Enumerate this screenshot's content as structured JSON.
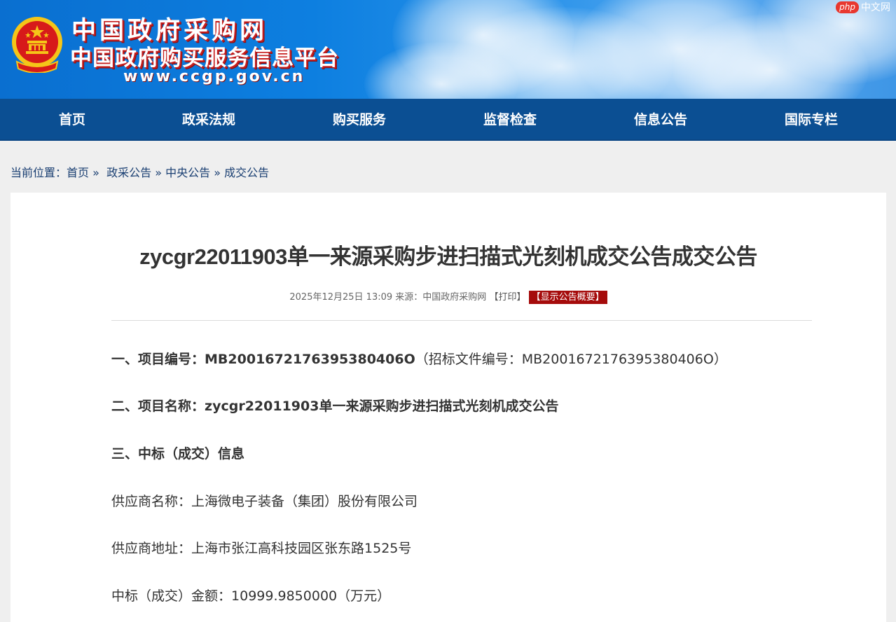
{
  "header": {
    "site_title": "中国政府采购网",
    "site_subtitle": "中国政府购买服务信息平台",
    "site_url": "www.ccgp.gov.cn",
    "watermark_badge": "php",
    "watermark_text": "中文网"
  },
  "nav": {
    "items": [
      {
        "label": "首页"
      },
      {
        "label": "政采法规"
      },
      {
        "label": "购买服务"
      },
      {
        "label": "监督检查"
      },
      {
        "label": "信息公告"
      },
      {
        "label": "国际专栏"
      }
    ]
  },
  "breadcrumb": {
    "prefix": "当前位置：",
    "items": [
      "首页",
      "政采公告",
      "中央公告",
      "成交公告"
    ],
    "separator": "»"
  },
  "article": {
    "title": "zycgr22011903单一来源采购步进扫描式光刻机成交公告成交公告",
    "meta_date": "2025年12月25日 13:09",
    "meta_source_label": "来源：",
    "meta_source": "中国政府采购网",
    "print_label": "【打印】",
    "summary_label": "【显示公告概要】",
    "sections": {
      "project_number_label": "一、项目编号：",
      "project_number": "MB2001672176395380406O",
      "bid_doc_number": "（招标文件编号：MB2001672176395380406O）",
      "project_name_label": "二、项目名称：",
      "project_name": "zycgr22011903单一来源采购步进扫描式光刻机成交公告",
      "award_info_label": "三、中标（成交）信息",
      "supplier_name_label": "供应商名称：",
      "supplier_name": "上海微电子装备（集团）股份有限公司",
      "supplier_address_label": "供应商地址：",
      "supplier_address": "上海市张江高科技园区张东路1525号",
      "amount_label": "中标（成交）金额：",
      "amount": "10999.9850000（万元）"
    }
  },
  "colors": {
    "nav_bg": "#0b4f93",
    "summary_btn_bg": "#a50b0b",
    "breadcrumb_text": "#1a3f72"
  }
}
